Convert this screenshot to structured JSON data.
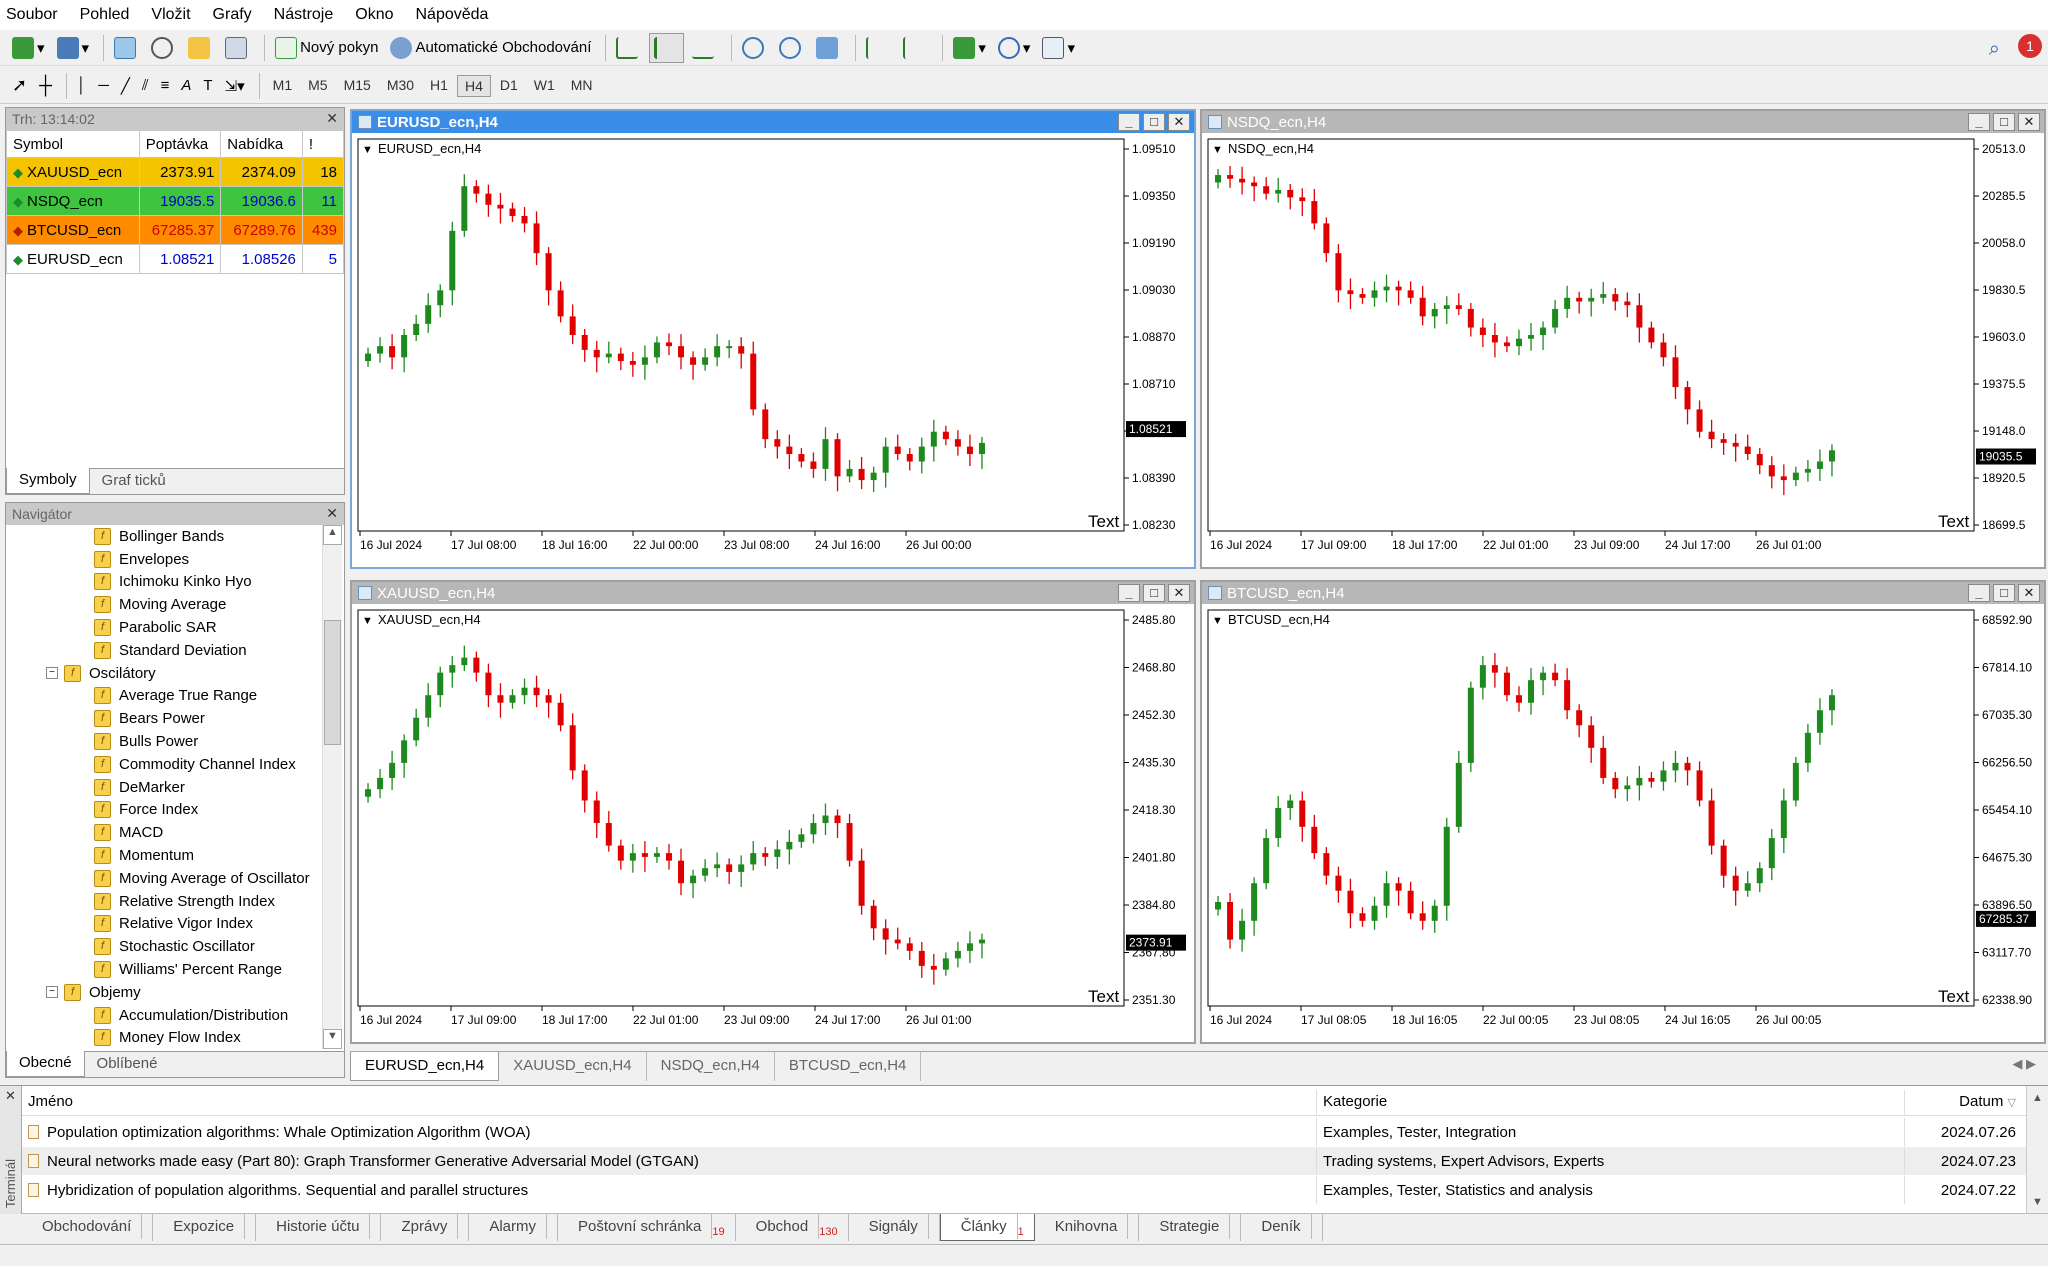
{
  "menu": [
    "Soubor",
    "Pohled",
    "Vložit",
    "Grafy",
    "Nástroje",
    "Okno",
    "Nápověda"
  ],
  "toolbar": {
    "new_order": "Nový pokyn",
    "auto_trading": "Automatické Obchodování",
    "timeframes": [
      "M1",
      "M5",
      "M15",
      "M30",
      "H1",
      "H4",
      "D1",
      "W1",
      "MN"
    ],
    "active_tf": "H4",
    "notif_count": "1"
  },
  "market_watch": {
    "title": "Trh: 13:14:02",
    "headers": [
      "Symbol",
      "Poptávka",
      "Nabídka",
      "!"
    ],
    "rows": [
      {
        "symbol": "XAUUSD_ecn",
        "bid": "2373.91",
        "ask": "2374.09",
        "spread": "18",
        "bg": "#f5c400",
        "color": "#000000",
        "dir": "up"
      },
      {
        "symbol": "NSDQ_ecn",
        "bid": "19035.5",
        "ask": "19036.6",
        "spread": "11",
        "bg": "#3ec43e",
        "color": "#0000cc",
        "dir": "up"
      },
      {
        "symbol": "BTCUSD_ecn",
        "bid": "67285.37",
        "ask": "67289.76",
        "spread": "439",
        "bg": "#ff8c00",
        "color": "#cc0000",
        "dir": "down"
      },
      {
        "symbol": "EURUSD_ecn",
        "bid": "1.08521",
        "ask": "1.08526",
        "spread": "5",
        "bg": "#ffffff",
        "color": "#0000cc",
        "dir": "up"
      }
    ],
    "tabs": [
      "Symboly",
      "Graf ticků"
    ]
  },
  "navigator": {
    "title": "Navigátor",
    "items": [
      {
        "label": "Bollinger Bands",
        "level": 2
      },
      {
        "label": "Envelopes",
        "level": 2
      },
      {
        "label": "Ichimoku Kinko Hyo",
        "level": 2
      },
      {
        "label": "Moving Average",
        "level": 2
      },
      {
        "label": "Parabolic SAR",
        "level": 2
      },
      {
        "label": "Standard Deviation",
        "level": 2
      },
      {
        "label": "Oscilátory",
        "level": 1
      },
      {
        "label": "Average True Range",
        "level": 2
      },
      {
        "label": "Bears Power",
        "level": 2
      },
      {
        "label": "Bulls Power",
        "level": 2
      },
      {
        "label": "Commodity Channel Index",
        "level": 2
      },
      {
        "label": "DeMarker",
        "level": 2
      },
      {
        "label": "Force Index",
        "level": 2
      },
      {
        "label": "MACD",
        "level": 2
      },
      {
        "label": "Momentum",
        "level": 2
      },
      {
        "label": "Moving Average of Oscillator",
        "level": 2
      },
      {
        "label": "Relative Strength Index",
        "level": 2
      },
      {
        "label": "Relative Vigor Index",
        "level": 2
      },
      {
        "label": "Stochastic Oscillator",
        "level": 2
      },
      {
        "label": "Williams' Percent Range",
        "level": 2
      },
      {
        "label": "Objemy",
        "level": 1
      },
      {
        "label": "Accumulation/Distribution",
        "level": 2
      },
      {
        "label": "Money Flow Index",
        "level": 2
      }
    ],
    "tabs": [
      "Obecné",
      "Oblíbené"
    ]
  },
  "charts": [
    {
      "title": "EURUSD_ecn,H4",
      "label": "EURUSD_ecn,H4",
      "active": true,
      "text_label": "Text",
      "yticks": [
        "1.09510",
        "1.09350",
        "1.09190",
        "1.09030",
        "1.08870",
        "1.08710",
        "1.08550",
        "1.08390",
        "1.08230"
      ],
      "xticks": [
        "16 Jul 2024",
        "17 Jul 08:00",
        "18 Jul 16:00",
        "22 Jul 00:00",
        "23 Jul 08:00",
        "24 Jul 16:00",
        "26 Jul 00:00"
      ],
      "price_tag": "1.08521",
      "price_tag_pos": 0.74,
      "series": [
        0.45,
        0.47,
        0.44,
        0.5,
        0.53,
        0.58,
        0.62,
        0.78,
        0.9,
        0.88,
        0.85,
        0.84,
        0.82,
        0.8,
        0.72,
        0.62,
        0.55,
        0.5,
        0.46,
        0.44,
        0.45,
        0.43,
        0.42,
        0.44,
        0.48,
        0.47,
        0.44,
        0.42,
        0.44,
        0.47,
        0.47,
        0.45,
        0.3,
        0.22,
        0.2,
        0.18,
        0.16,
        0.14,
        0.22,
        0.12,
        0.14,
        0.11,
        0.13,
        0.2,
        0.18,
        0.16,
        0.2,
        0.24,
        0.22,
        0.2,
        0.18,
        0.21
      ]
    },
    {
      "title": "NSDQ_ecn,H4",
      "label": "NSDQ_ecn,H4",
      "active": false,
      "text_label": "Text",
      "yticks": [
        "20513.0",
        "20285.5",
        "20058.0",
        "19830.5",
        "19603.0",
        "19375.5",
        "19148.0",
        "18920.5",
        "18699.5"
      ],
      "xticks": [
        "16 Jul 2024",
        "17 Jul 09:00",
        "18 Jul 17:00",
        "22 Jul 01:00",
        "23 Jul 09:00",
        "24 Jul 17:00",
        "26 Jul 01:00"
      ],
      "price_tag": "19035.5",
      "price_tag_pos": 0.81,
      "series": [
        0.93,
        0.92,
        0.91,
        0.9,
        0.88,
        0.89,
        0.87,
        0.86,
        0.8,
        0.72,
        0.62,
        0.61,
        0.6,
        0.62,
        0.63,
        0.62,
        0.6,
        0.55,
        0.57,
        0.58,
        0.57,
        0.52,
        0.5,
        0.48,
        0.47,
        0.49,
        0.5,
        0.52,
        0.57,
        0.6,
        0.59,
        0.6,
        0.61,
        0.59,
        0.58,
        0.52,
        0.48,
        0.44,
        0.36,
        0.3,
        0.24,
        0.22,
        0.21,
        0.2,
        0.18,
        0.15,
        0.12,
        0.11,
        0.13,
        0.14,
        0.16,
        0.19
      ]
    },
    {
      "title": "XAUUSD_ecn,H4",
      "label": "XAUUSD_ecn,H4",
      "active": false,
      "text_label": "Text",
      "yticks": [
        "2485.80",
        "2468.80",
        "2452.30",
        "2435.30",
        "2418.30",
        "2401.80",
        "2384.80",
        "2367.80",
        "2351.30"
      ],
      "xticks": [
        "16 Jul 2024",
        "17 Jul 09:00",
        "18 Jul 17:00",
        "22 Jul 01:00",
        "23 Jul 09:00",
        "24 Jul 17:00",
        "26 Jul 01:00"
      ],
      "price_tag": "2373.91",
      "price_tag_pos": 0.84,
      "series": [
        0.55,
        0.58,
        0.62,
        0.68,
        0.74,
        0.8,
        0.86,
        0.88,
        0.9,
        0.86,
        0.8,
        0.78,
        0.8,
        0.82,
        0.8,
        0.78,
        0.72,
        0.6,
        0.52,
        0.46,
        0.4,
        0.36,
        0.38,
        0.37,
        0.38,
        0.36,
        0.3,
        0.32,
        0.34,
        0.35,
        0.33,
        0.35,
        0.38,
        0.37,
        0.39,
        0.41,
        0.43,
        0.46,
        0.48,
        0.46,
        0.36,
        0.24,
        0.18,
        0.15,
        0.14,
        0.12,
        0.08,
        0.07,
        0.1,
        0.12,
        0.14,
        0.15
      ]
    },
    {
      "title": "BTCUSD_ecn,H4",
      "label": "BTCUSD_ecn,H4",
      "active": false,
      "text_label": "Text",
      "yticks": [
        "68592.90",
        "67814.10",
        "67035.30",
        "66256.50",
        "65454.10",
        "64675.30",
        "63896.50",
        "63117.70",
        "62338.90"
      ],
      "xticks": [
        "16 Jul 2024",
        "17 Jul 08:05",
        "18 Jul 16:05",
        "22 Jul 00:05",
        "23 Jul 08:05",
        "24 Jul 16:05",
        "26 Jul 00:05"
      ],
      "price_tag": "67285.37",
      "price_tag_pos": 0.78,
      "series": [
        0.25,
        0.15,
        0.2,
        0.3,
        0.42,
        0.5,
        0.52,
        0.45,
        0.38,
        0.32,
        0.28,
        0.22,
        0.2,
        0.24,
        0.3,
        0.28,
        0.22,
        0.2,
        0.24,
        0.45,
        0.62,
        0.82,
        0.88,
        0.86,
        0.8,
        0.78,
        0.84,
        0.86,
        0.84,
        0.76,
        0.72,
        0.66,
        0.58,
        0.55,
        0.56,
        0.58,
        0.57,
        0.6,
        0.62,
        0.6,
        0.52,
        0.4,
        0.32,
        0.28,
        0.3,
        0.34,
        0.42,
        0.52,
        0.62,
        0.7,
        0.76,
        0.8
      ]
    }
  ],
  "chart_tabs": [
    "EURUSD_ecn,H4",
    "XAUUSD_ecn,H4",
    "NSDQ_ecn,H4",
    "BTCUSD_ecn,H4"
  ],
  "terminal": {
    "side_label": "Terminál",
    "headers": {
      "name": "Jméno",
      "category": "Kategorie",
      "date": "Datum"
    },
    "rows": [
      {
        "name": "Population optimization algorithms: Whale Optimization Algorithm (WOA)",
        "category": "Examples, Tester, Integration",
        "date": "2024.07.26"
      },
      {
        "name": "Neural networks made easy (Part 80): Graph Transformer Generative Adversarial Model (GTGAN)",
        "category": "Trading systems, Expert Advisors, Experts",
        "date": "2024.07.23"
      },
      {
        "name": "Hybridization of population algorithms. Sequential and parallel structures",
        "category": "Examples, Tester, Statistics and analysis",
        "date": "2024.07.22"
      }
    ],
    "tabs": [
      {
        "label": "Obchodování",
        "badge": ""
      },
      {
        "label": "Expozice",
        "badge": ""
      },
      {
        "label": "Historie účtu",
        "badge": ""
      },
      {
        "label": "Zprávy",
        "badge": ""
      },
      {
        "label": "Alarmy",
        "badge": ""
      },
      {
        "label": "Poštovní schránka",
        "badge": "19"
      },
      {
        "label": "Obchod",
        "badge": "130"
      },
      {
        "label": "Signály",
        "badge": ""
      },
      {
        "label": "Články",
        "badge": "1"
      },
      {
        "label": "Knihovna",
        "badge": ""
      },
      {
        "label": "Strategie",
        "badge": ""
      },
      {
        "label": "Deník",
        "badge": ""
      }
    ],
    "active_tab": "Články"
  },
  "colors": {
    "bull": "#1e8a1e",
    "bear": "#e00000"
  }
}
